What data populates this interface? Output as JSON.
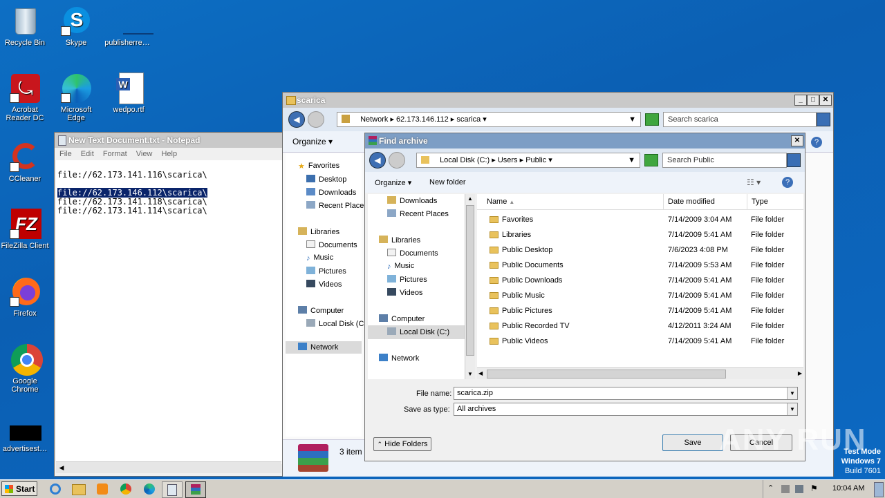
{
  "desktop": {
    "icons": [
      {
        "label": "Recycle Bin",
        "icon": "recycle-bin-icon"
      },
      {
        "label": "Skype",
        "icon": "skype-icon"
      },
      {
        "label": "publisherre…",
        "icon": "file-icon"
      },
      {
        "label": "Acrobat Reader DC",
        "icon": "acrobat-icon"
      },
      {
        "label": "Microsoft Edge",
        "icon": "edge-icon"
      },
      {
        "label": "wedpo.rtf",
        "icon": "word-doc-icon"
      },
      {
        "label": "CCleaner",
        "icon": "ccleaner-icon"
      },
      {
        "label": "FileZilla Client",
        "icon": "filezilla-icon"
      },
      {
        "label": "Firefox",
        "icon": "firefox-icon"
      },
      {
        "label": "Google Chrome",
        "icon": "chrome-icon"
      },
      {
        "label": "advertisest…",
        "icon": "black-file-icon"
      }
    ],
    "watermark": {
      "mode": "Test Mode",
      "os": "Windows 7",
      "build": "Build 7601"
    },
    "anyrun": "ANY RUN"
  },
  "notepad": {
    "title": "New Text Document.txt - Notepad",
    "menu": [
      "File",
      "Edit",
      "Format",
      "View",
      "Help"
    ],
    "lines": [
      "file://62.173.141.116\\scarica\\",
      "",
      "file://62.173.146.112\\scarica\\",
      "file://62.173.141.118\\scarica\\",
      "file://62.173.141.114\\scarica\\"
    ]
  },
  "explorer": {
    "title": "scarica",
    "breadcrumb": [
      "Network",
      "62.173.146.112",
      "scarica"
    ],
    "search_placeholder": "Search scarica",
    "organize": "Organize",
    "nav": {
      "favorites": "Favorites",
      "desktop": "Desktop",
      "downloads": "Downloads",
      "recent": "Recent Place",
      "libraries": "Libraries",
      "documents": "Documents",
      "music": "Music",
      "pictures": "Pictures",
      "videos": "Videos",
      "computer": "Computer",
      "localdisk": "Local Disk (C",
      "network": "Network"
    },
    "status": "3 item"
  },
  "dialog": {
    "title": "Find archive",
    "breadcrumb": [
      "Local Disk (C:)",
      "Users",
      "Public"
    ],
    "search_placeholder": "Search Public",
    "organize": "Organize",
    "new_folder": "New folder",
    "nav": {
      "downloads": "Downloads",
      "recent": "Recent Places",
      "libraries": "Libraries",
      "documents": "Documents",
      "music": "Music",
      "pictures": "Pictures",
      "videos": "Videos",
      "computer": "Computer",
      "localdisk": "Local Disk (C:)",
      "network": "Network"
    },
    "columns": {
      "name": "Name",
      "date": "Date modified",
      "type": "Type"
    },
    "files": [
      {
        "name": "Favorites",
        "date": "7/14/2009 3:04 AM",
        "type": "File folder"
      },
      {
        "name": "Libraries",
        "date": "7/14/2009 5:41 AM",
        "type": "File folder"
      },
      {
        "name": "Public Desktop",
        "date": "7/6/2023 4:08 PM",
        "type": "File folder"
      },
      {
        "name": "Public Documents",
        "date": "7/14/2009 5:53 AM",
        "type": "File folder"
      },
      {
        "name": "Public Downloads",
        "date": "7/14/2009 5:41 AM",
        "type": "File folder"
      },
      {
        "name": "Public Music",
        "date": "7/14/2009 5:41 AM",
        "type": "File folder"
      },
      {
        "name": "Public Pictures",
        "date": "7/14/2009 5:41 AM",
        "type": "File folder"
      },
      {
        "name": "Public Recorded TV",
        "date": "4/12/2011 3:24 AM",
        "type": "File folder"
      },
      {
        "name": "Public Videos",
        "date": "7/14/2009 5:41 AM",
        "type": "File folder"
      }
    ],
    "filename_label": "File name:",
    "filename_value": "scarica.zip",
    "savetype_label": "Save as type:",
    "savetype_value": "All archives",
    "hide_folders": "Hide Folders",
    "save": "Save",
    "cancel": "Cancel"
  },
  "taskbar": {
    "start": "Start",
    "clock": "10:04 AM"
  }
}
